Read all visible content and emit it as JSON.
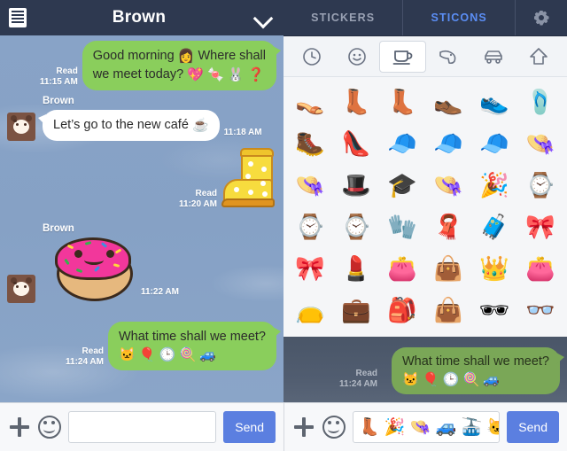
{
  "chat": {
    "header": {
      "title": "Brown",
      "menu_icon": "list-menu-icon",
      "chevron_icon": "chevron-down-icon"
    },
    "messages": [
      {
        "id": "msg-1",
        "side": "outgoing",
        "type": "text",
        "text": "Good morning",
        "text2": "we meet today?",
        "text_mid": "Where shall",
        "emoji_inline": "👩",
        "emoji_tail": "💖 🍬 🐰 ❓",
        "status": "Read",
        "time": "11:15 AM"
      },
      {
        "id": "msg-2",
        "side": "incoming",
        "type": "text",
        "sender": "Brown",
        "text": "Let’s go to the new café",
        "emoji_tail": "☕",
        "time": "11:18 AM"
      },
      {
        "id": "msg-3",
        "side": "outgoing",
        "type": "sticker",
        "sticker": "yellow-polka-dot-rain-boot-sticker",
        "status": "Read",
        "time": "11:20 AM"
      },
      {
        "id": "msg-4",
        "side": "incoming",
        "type": "sticker",
        "sender": "Brown",
        "sticker": "pink-donut-sticker",
        "time": "11:22 AM"
      },
      {
        "id": "msg-5",
        "side": "outgoing",
        "type": "text",
        "text": "What time shall we meet?",
        "emoji_tail": "🐱 🎈 🕒 🍭 🚙",
        "status": "Read",
        "time": "11:24 AM"
      }
    ],
    "input": {
      "plus_icon": "plus-icon",
      "emoji_icon": "smiley-icon",
      "value": "",
      "placeholder": "",
      "send_label": "Send"
    }
  },
  "sticker_panel": {
    "tabs": [
      {
        "label": "STICKERS",
        "active": false
      },
      {
        "label": "STICONS",
        "active": true
      }
    ],
    "settings_icon": "gear-icon",
    "categories": [
      {
        "name": "recent-clock-icon",
        "glyph": "🕐",
        "active": false
      },
      {
        "name": "emotions-smiley-icon",
        "glyph": "🙂",
        "active": false
      },
      {
        "name": "objects-cup-icon",
        "glyph": "☕",
        "active": true
      },
      {
        "name": "animals-dog-icon",
        "glyph": "🐶",
        "active": false
      },
      {
        "name": "vehicles-car-icon",
        "glyph": "🚗",
        "active": false
      },
      {
        "name": "places-arrow-icon",
        "glyph": "⬆",
        "active": false
      }
    ],
    "grid": [
      {
        "name": "sandal-emoji",
        "glyph": "👡"
      },
      {
        "name": "ankle-boot-emoji",
        "glyph": "👢"
      },
      {
        "name": "rain-boot-emoji",
        "glyph": "👢"
      },
      {
        "name": "dress-shoe-emoji",
        "glyph": "👞"
      },
      {
        "name": "sneaker-emoji",
        "glyph": "👟"
      },
      {
        "name": "flip-flop-emoji",
        "glyph": "🩴"
      },
      {
        "name": "cowboy-boot-emoji",
        "glyph": "🥾"
      },
      {
        "name": "high-heel-emoji",
        "glyph": "👠"
      },
      {
        "name": "baseball-cap-emoji",
        "glyph": "🧢"
      },
      {
        "name": "visor-emoji",
        "glyph": "🧢"
      },
      {
        "name": "flat-cap-emoji",
        "glyph": "🧢"
      },
      {
        "name": "straw-hat-emoji",
        "glyph": "👒"
      },
      {
        "name": "sun-hat-emoji",
        "glyph": "👒"
      },
      {
        "name": "fedora-emoji",
        "glyph": "🎩"
      },
      {
        "name": "graduation-cap-emoji",
        "glyph": "🎓"
      },
      {
        "name": "headband-emoji",
        "glyph": "👒"
      },
      {
        "name": "party-hat-emoji",
        "glyph": "🎉"
      },
      {
        "name": "watch-emoji",
        "glyph": "⌚"
      },
      {
        "name": "digital-watch-emoji",
        "glyph": "⌚"
      },
      {
        "name": "square-watch-emoji",
        "glyph": "⌚"
      },
      {
        "name": "gloves-emoji",
        "glyph": "🧤"
      },
      {
        "name": "scarf-emoji",
        "glyph": "🧣"
      },
      {
        "name": "suitcase-emoji",
        "glyph": "🧳"
      },
      {
        "name": "pink-bow-emoji",
        "glyph": "🎀"
      },
      {
        "name": "red-ribbon-emoji",
        "glyph": "🎀"
      },
      {
        "name": "lipstick-emoji",
        "glyph": "💄"
      },
      {
        "name": "coin-purse-emoji",
        "glyph": "👛"
      },
      {
        "name": "handbag-emoji",
        "glyph": "👜"
      },
      {
        "name": "crown-emoji",
        "glyph": "👑"
      },
      {
        "name": "wallet-emoji",
        "glyph": "👛"
      },
      {
        "name": "clutch-bag-emoji",
        "glyph": "👝"
      },
      {
        "name": "briefcase-emoji",
        "glyph": "💼"
      },
      {
        "name": "backpack-emoji",
        "glyph": "🎒"
      },
      {
        "name": "tote-bag-emoji",
        "glyph": "👜"
      },
      {
        "name": "sunglasses-emoji",
        "glyph": "🕶"
      },
      {
        "name": "blue-glasses-emoji",
        "glyph": "👓"
      }
    ],
    "preview": {
      "text": "What time shall we meet?",
      "emoji_tail": "🐱 🎈 🕒 🍭 🚙",
      "status": "Read",
      "time": "11:24 AM"
    },
    "input": {
      "plus_icon": "plus-icon",
      "emoji_icon": "smiley-icon",
      "composed_emoji": "👢 🎉 👒 🚙 🚠 🐱",
      "send_label": "Send"
    }
  },
  "colors": {
    "header_navy": "#2e3950",
    "chat_sky": "#86a1c5",
    "bubble_green": "#8ace5c",
    "bubble_white": "#ffffff",
    "send_blue": "#5b7fe0",
    "tab_active_blue": "#5b8ef5",
    "tab_inactive_gray": "#9aa2b4",
    "panel_bg": "#f5f6f8"
  }
}
